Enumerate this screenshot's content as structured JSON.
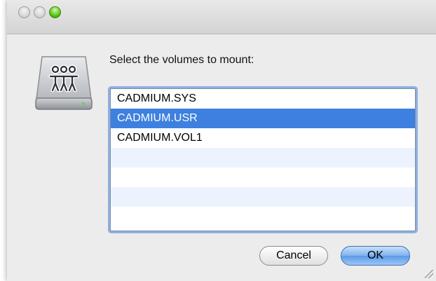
{
  "dialog": {
    "prompt": "Select the volumes to mount:",
    "volumes": [
      {
        "label": "CADMIUM.SYS",
        "selected": false
      },
      {
        "label": "CADMIUM.USR",
        "selected": true
      },
      {
        "label": "CADMIUM.VOL1",
        "selected": false
      }
    ],
    "cancel_label": "Cancel",
    "ok_label": "OK"
  },
  "icons": {
    "drive": "network-volume-icon",
    "close": "close-icon",
    "minimize": "minimize-icon",
    "zoom": "zoom-icon",
    "resize": "resize-grip-icon"
  },
  "colors": {
    "selection": "#3d80df",
    "alternate_row": "#edf3fe",
    "focus_ring": "#8fb0e0",
    "default_button": "#5b9ae8"
  }
}
